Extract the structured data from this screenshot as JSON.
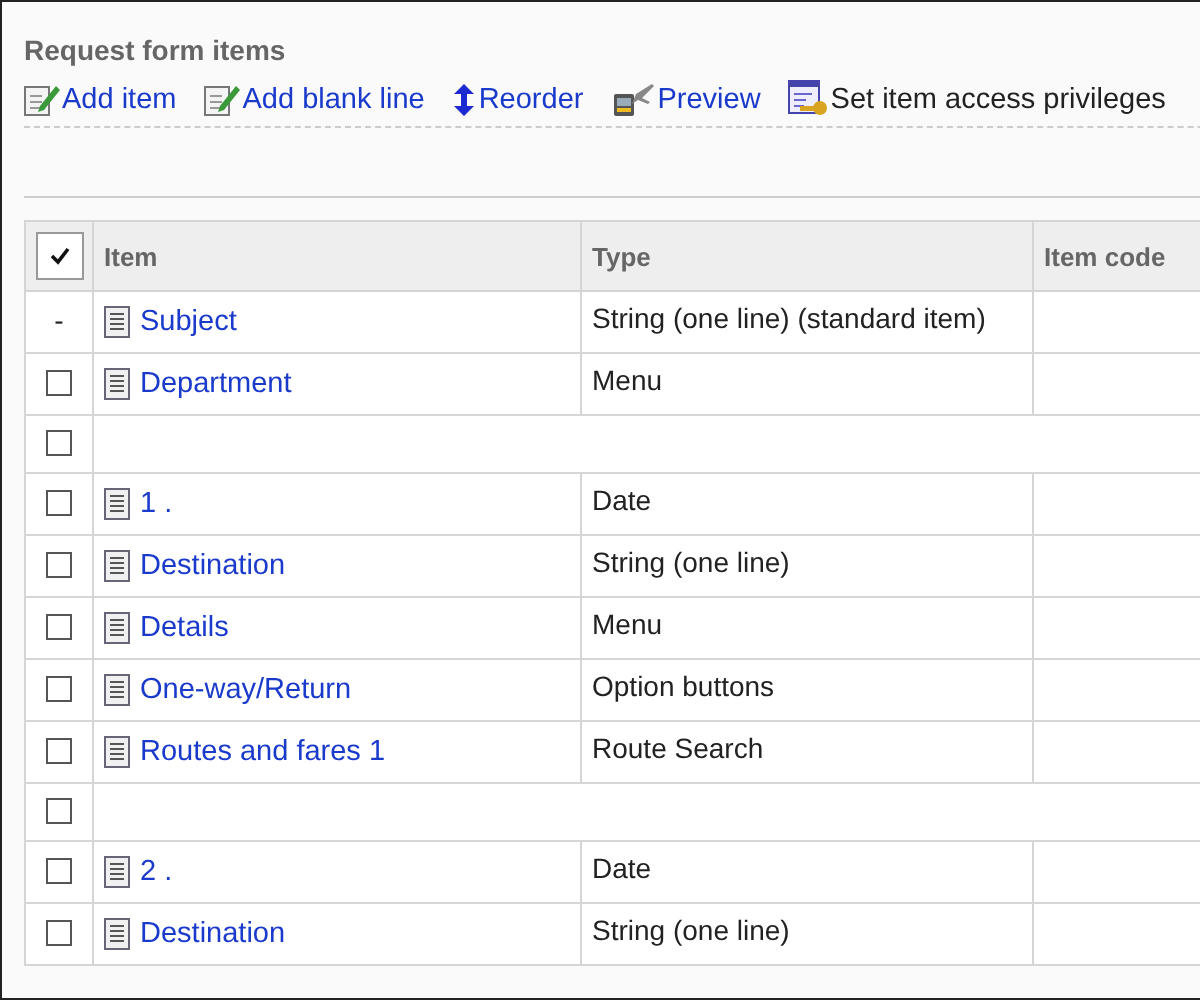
{
  "section_title": "Request form items",
  "toolbar": [
    {
      "label": "Add item",
      "kind": "add",
      "link": true
    },
    {
      "label": "Add blank line",
      "kind": "add",
      "link": true
    },
    {
      "label": "Reorder",
      "kind": "reorder",
      "link": true
    },
    {
      "label": "Preview",
      "kind": "preview",
      "link": true
    },
    {
      "label": "Set item access privileges",
      "kind": "privileges",
      "link": false
    }
  ],
  "table": {
    "columns": [
      "Item",
      "Type",
      "Item code"
    ],
    "select_all": {
      "checked": true
    },
    "rows": [
      {
        "kind": "standard",
        "marker": "-",
        "item": "Subject",
        "type": "String (one line) (standard item)"
      },
      {
        "kind": "item",
        "checked": false,
        "item": "Department",
        "type": "Menu"
      },
      {
        "kind": "blank",
        "checked": false
      },
      {
        "kind": "item",
        "checked": false,
        "item": "1 .",
        "type": "Date"
      },
      {
        "kind": "item",
        "checked": false,
        "item": "Destination",
        "type": "String (one line)"
      },
      {
        "kind": "item",
        "checked": false,
        "item": "Details",
        "type": "Menu"
      },
      {
        "kind": "item",
        "checked": false,
        "item": "One-way/Return",
        "type": "Option buttons"
      },
      {
        "kind": "item",
        "checked": false,
        "item": "Routes and fares 1",
        "type": "Route Search"
      },
      {
        "kind": "blank",
        "checked": false
      },
      {
        "kind": "item",
        "checked": false,
        "item": "2 .",
        "type": "Date"
      },
      {
        "kind": "item",
        "checked": false,
        "item": "Destination",
        "type": "String (one line)"
      }
    ]
  }
}
